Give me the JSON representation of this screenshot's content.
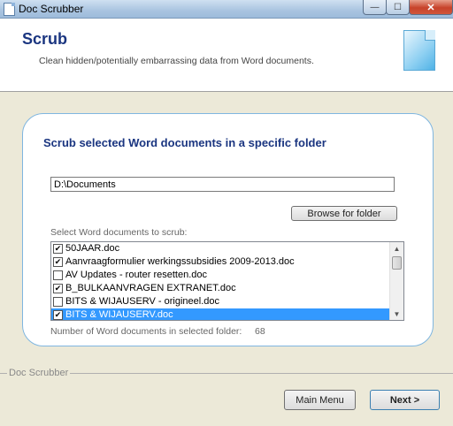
{
  "window": {
    "title": "Doc Scrubber",
    "minimize": "—",
    "maximize": "☐",
    "close": "✕"
  },
  "header": {
    "title": "Scrub",
    "subtitle": "Clean hidden/potentially embarrassing data from Word documents.",
    "icon": "document-icon"
  },
  "panel": {
    "title": "Scrub selected Word documents in a specific folder",
    "folder_path": "D:\\Documents",
    "browse_label": "Browse for folder",
    "list_label": "Select Word documents to scrub:",
    "documents": [
      {
        "name": "50JAAR.doc",
        "checked": true,
        "selected": false
      },
      {
        "name": "Aanvraagformulier werkingssubsidies 2009-2013.doc",
        "checked": true,
        "selected": false
      },
      {
        "name": "AV Updates - router resetten.doc",
        "checked": false,
        "selected": false
      },
      {
        "name": "B_BULKAANVRAGEN EXTRANET.doc",
        "checked": true,
        "selected": false
      },
      {
        "name": "BITS & WIJAUSERV - origineel.doc",
        "checked": false,
        "selected": false
      },
      {
        "name": "BITS & WIJAUSERV.doc",
        "checked": true,
        "selected": true
      }
    ],
    "count_label": "Number of Word documents in selected folder:",
    "count_value": "68"
  },
  "footer": {
    "group_label": "Doc Scrubber",
    "main_menu_label": "Main Menu",
    "next_label": "Next >"
  }
}
